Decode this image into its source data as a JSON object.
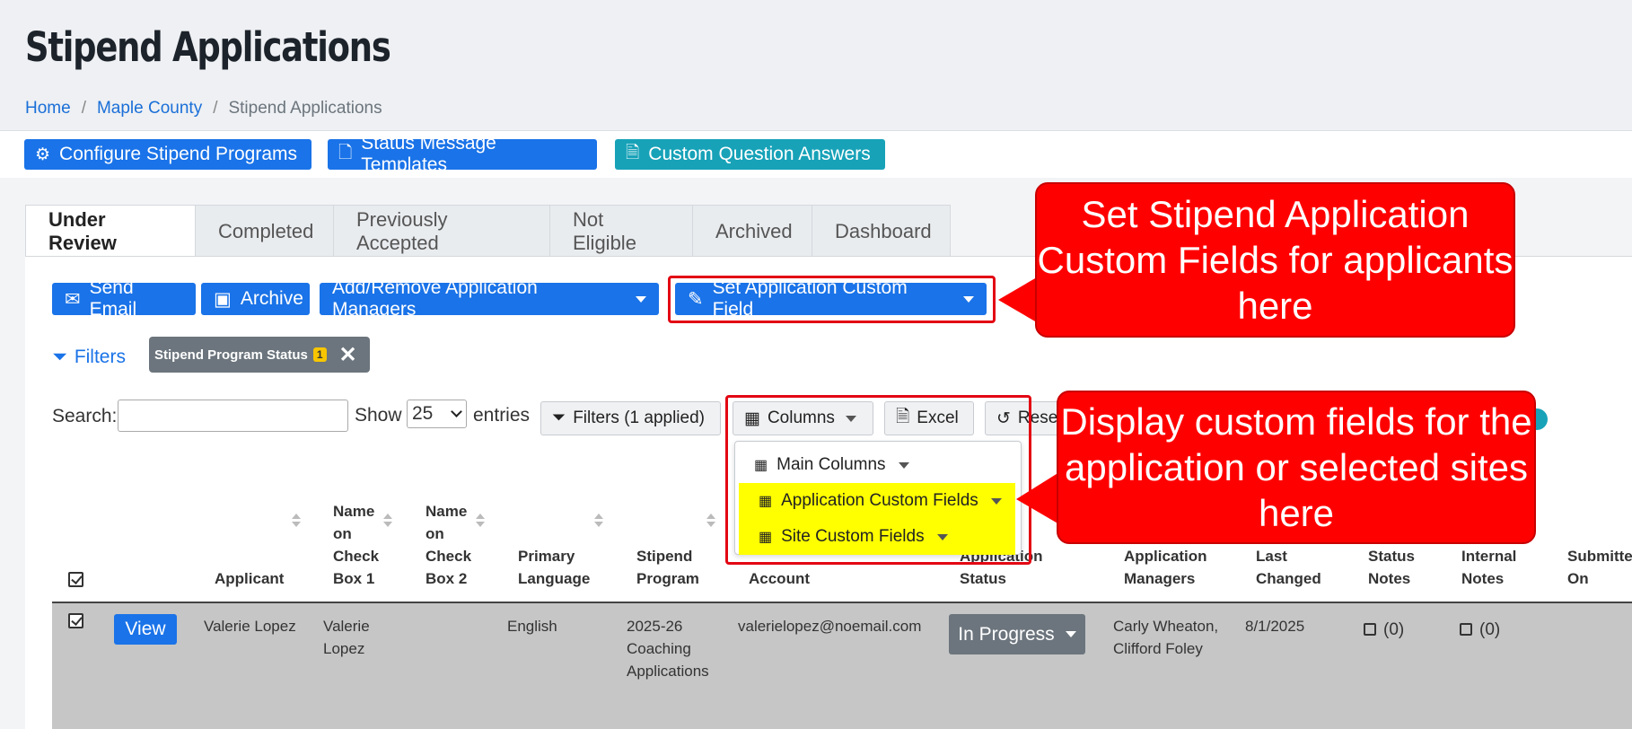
{
  "page": {
    "title": "Stipend Applications",
    "breadcrumb": [
      {
        "label": "Home",
        "link": true
      },
      {
        "label": "Maple County",
        "link": true
      },
      {
        "label": "Stipend Applications",
        "link": false
      }
    ]
  },
  "top_buttons": {
    "configure": "Configure Stipend Programs",
    "status_templates": "Status Message Templates",
    "custom_answers": "Custom Question Answers"
  },
  "tabs": [
    "Under Review",
    "Completed",
    "Previously Accepted",
    "Not Eligible",
    "Archived",
    "Dashboard"
  ],
  "actions": {
    "send_email": "Send Email",
    "archive": "Archive",
    "managers": "Add/Remove Application Managers",
    "custom_field": "Set Application Custom Field"
  },
  "filters": {
    "link": "Filters",
    "chip_label": "Stipend Program Status",
    "chip_count": "1"
  },
  "table_controls": {
    "search_label": "Search:",
    "search_value": "",
    "show_label": "Show",
    "entries_value": "25",
    "entries_label": "entries",
    "filters_button": "Filters (1 applied)",
    "columns_button": "Columns",
    "excel_button": "Excel",
    "reset_button": "Rese"
  },
  "columns_dropdown": [
    "Main Columns",
    "Application Custom Fields",
    "Site Custom Fields"
  ],
  "callouts": {
    "custom_field": "Set Stipend Application Custom Fields for applicants here",
    "columns": "Display custom fields for the application or selected sites here"
  },
  "table": {
    "headers": {
      "applicant": "Applicant",
      "name1": [
        "Name",
        "on",
        "Check",
        "Box 1"
      ],
      "name2": [
        "Name",
        "on",
        "Check",
        "Box 2"
      ],
      "language": [
        "Primary",
        "Language"
      ],
      "program": [
        "Stipend",
        "Program"
      ],
      "account": "Account",
      "status": [
        "Application",
        "Status"
      ],
      "managers": [
        "Application",
        "Managers"
      ],
      "changed": [
        "Last",
        "Changed"
      ],
      "status_notes": [
        "Status",
        "Notes"
      ],
      "internal_notes": [
        "Internal",
        "Notes"
      ],
      "submitted": [
        "Submitte",
        "On"
      ]
    },
    "row": {
      "view": "View",
      "applicant": "Valerie Lopez",
      "name1": [
        "Valerie",
        "Lopez"
      ],
      "language": "English",
      "program": [
        "2025-26",
        "Coaching",
        "Applications"
      ],
      "account": "valerielopez@noemail.com",
      "status": "In Progress",
      "managers": [
        "Carly Wheaton,",
        "Clifford Foley"
      ],
      "changed": "8/1/2025",
      "status_notes": "(0)",
      "internal_notes": "(0)"
    }
  }
}
